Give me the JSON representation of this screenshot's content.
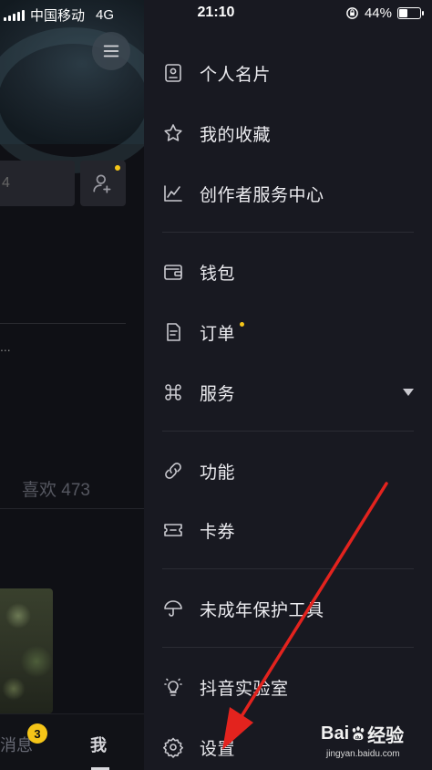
{
  "status_bar": {
    "carrier": "中国移动",
    "network": "4G",
    "time": "21:10",
    "battery_percent": "44%",
    "battery_level": 0.44
  },
  "background": {
    "likes_label": "喜欢 473",
    "tab_messages": "消息",
    "tab_messages_badge": "3",
    "tab_me": "我",
    "ellipsis": "..."
  },
  "drawer": {
    "items": [
      {
        "label": "个人名片",
        "icon": "id-card-icon"
      },
      {
        "label": "我的收藏",
        "icon": "star-icon"
      },
      {
        "label": "创作者服务中心",
        "icon": "chart-line-icon"
      },
      {
        "label": "钱包",
        "icon": "wallet-icon"
      },
      {
        "label": "订单",
        "icon": "order-icon",
        "has_dot": true
      },
      {
        "label": "服务",
        "icon": "services-icon",
        "has_chevron": true
      },
      {
        "label": "功能",
        "icon": "link-icon"
      },
      {
        "label": "卡券",
        "icon": "coupon-icon"
      },
      {
        "label": "未成年保护工具",
        "icon": "umbrella-icon"
      },
      {
        "label": "抖音实验室",
        "icon": "bulb-icon"
      },
      {
        "label": "设置",
        "icon": "gear-icon"
      }
    ]
  },
  "watermark": {
    "logo": "Bai du 经验",
    "site": "jingyan.baidu.com"
  },
  "colors": {
    "drawer_bg": "#181921",
    "accent_dot": "#f5c518",
    "annotation_arrow": "#e3231e"
  }
}
